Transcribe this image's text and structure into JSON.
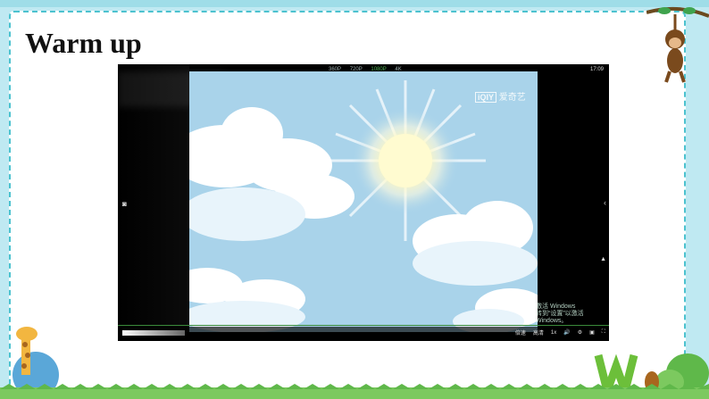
{
  "slide": {
    "title": "Warm up"
  },
  "player": {
    "quality_options": [
      "360P",
      "720P",
      "1080P",
      "4K"
    ],
    "selected_quality": "1080P",
    "time": "17:09",
    "brand_mark": "iQIY",
    "brand_text": "爱奇艺",
    "windows_watermark_line1": "激活 Windows",
    "windows_watermark_line2": "转到“设置”以激活 Windows。",
    "control_labels": [
      "倍速",
      "高清",
      "1x"
    ],
    "accent_color": "#3a8a3a"
  },
  "colors": {
    "frame_border": "#4cc2cf",
    "background": "#bfe9f2",
    "sky": "#a9d3ea"
  }
}
